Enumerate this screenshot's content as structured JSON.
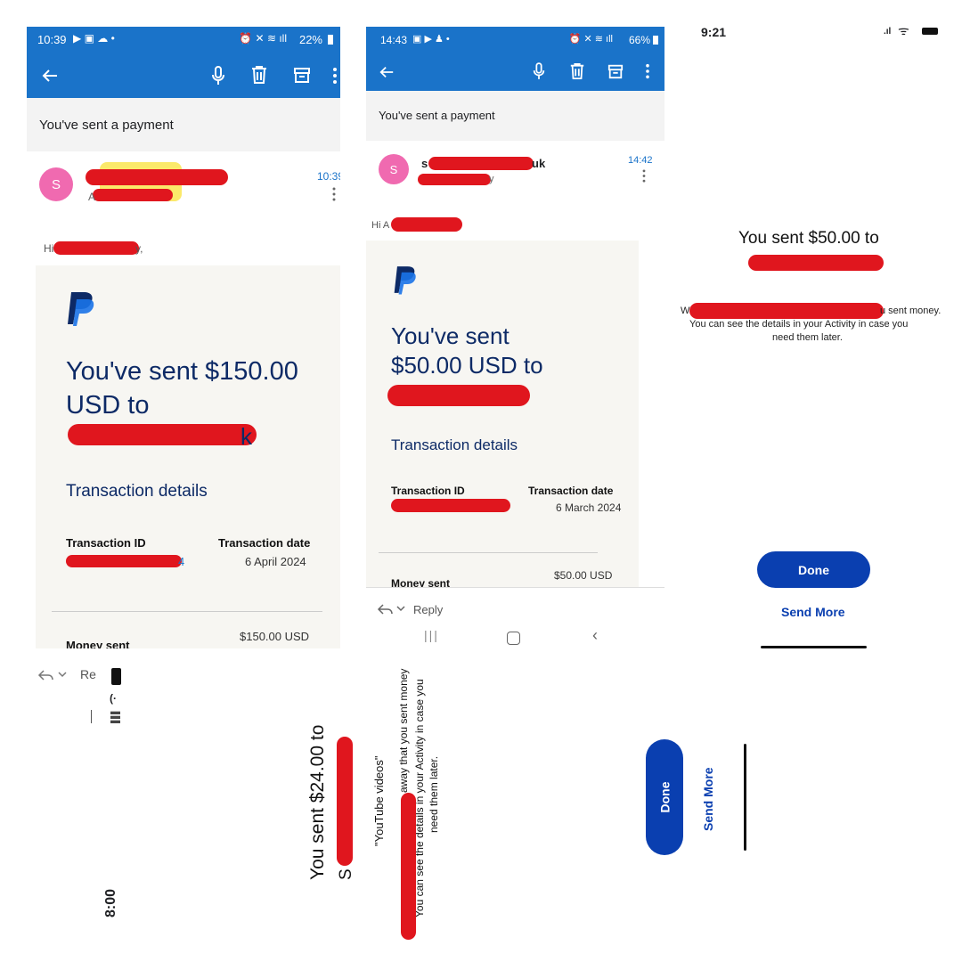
{
  "panel1": {
    "status_time": "10:39",
    "status_right": "22%",
    "subject": "You've sent a payment",
    "avatar_letter": "S",
    "email_time": "10:39",
    "greeting_start": "Hi",
    "greeting_end": "y,",
    "headline": "You've sent $150.00 USD to",
    "name_tail": "k",
    "section_title": "Transaction details",
    "tid_label": "Transaction ID",
    "tid_tail": "4",
    "date_label": "Transaction date",
    "date_value": "6 April 2024",
    "money_label": "Money sent",
    "money_value": "$150.00 USD",
    "reply_label": "Re"
  },
  "panel2": {
    "status_time": "14:43",
    "status_right": "66%",
    "subject": "You've sent a payment",
    "avatar_letter": "S",
    "sender_start": "s",
    "sender_end": "uk",
    "sender_sub_end": "y",
    "email_time": "14:42",
    "greeting_start": "Hi A",
    "headline_line1": "You've sent",
    "headline_line2": "$50.00 USD to",
    "section_title": "Transaction details",
    "tid_label": "Transaction ID",
    "date_label": "Transaction date",
    "date_value": "6 March 2024",
    "money_label": "Money sent",
    "money_value": "$50.00 USD",
    "reply_label": "Reply"
  },
  "panel3": {
    "status_time": "9:21",
    "headline": "You sent $50.00 to",
    "body_start": "W",
    "body_end": "u sent money.",
    "body_line2": "You can see the details in your Activity in case you",
    "body_line3": "need them later.",
    "done_label": "Done",
    "send_more_label": "Send More"
  },
  "panel4": {
    "status_time": "8:00",
    "headline": "You sent $24.00 to",
    "name_tail": "S",
    "quote": "\"YouTube videos\"",
    "body_line1": "away that you sent money",
    "body_line2": "You can see the details in your Activity in case you",
    "body_line3": "need them later.",
    "done_label": "Done",
    "send_more_label": "Send More"
  },
  "colors": {
    "outlook_blue": "#1a73c9",
    "paypal_navy": "#0d2a66",
    "paypal_blue": "#0a3fb0",
    "redaction": "#e0161e",
    "avatar_pink": "#f06ab0"
  }
}
